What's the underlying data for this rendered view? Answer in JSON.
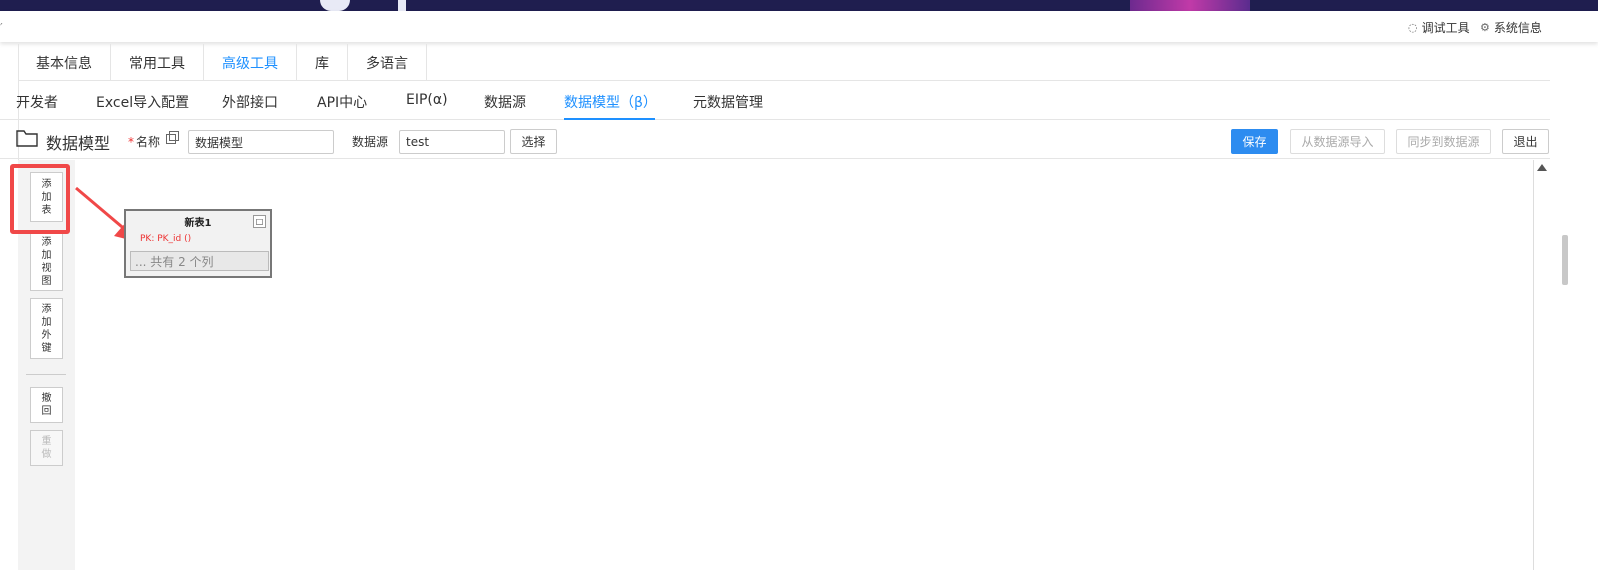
{
  "topbar": {
    "debug_tool": "调试工具",
    "system_info": "系统信息"
  },
  "tabs_primary": [
    {
      "label": "基本信息",
      "active": false
    },
    {
      "label": "常用工具",
      "active": false
    },
    {
      "label": "高级工具",
      "active": true
    },
    {
      "label": "库",
      "active": false
    },
    {
      "label": "多语言",
      "active": false
    }
  ],
  "tabs_secondary": [
    {
      "label": "开发者",
      "active": false
    },
    {
      "label": "Excel导入配置",
      "active": false
    },
    {
      "label": "外部接口",
      "active": false
    },
    {
      "label": "API中心",
      "active": false
    },
    {
      "label": "EIP(α)",
      "active": false
    },
    {
      "label": "数据源",
      "active": false
    },
    {
      "label": "数据模型（β）",
      "active": true
    },
    {
      "label": "元数据管理",
      "active": false
    }
  ],
  "toolbar": {
    "title": "数据模型",
    "name_label": "名称",
    "name_required": "*",
    "name_value": "数据模型",
    "datasource_label": "数据源",
    "datasource_value": "test",
    "select_button": "选择",
    "save_button": "保存",
    "import_button": "从数据源导入",
    "sync_button": "同步到数据源",
    "exit_button": "退出"
  },
  "sidebar": {
    "add_table": "添加表",
    "add_view": "添加视图",
    "add_foreign_key": "添加外键",
    "undo": "撤回",
    "redo": "重做"
  },
  "table_node": {
    "name": "新表1",
    "pk": "PK: PK_id ()",
    "columns_summary": "... 共有 2 个列",
    "minimize_glyph": "□"
  },
  "colors": {
    "accent": "#1e90ff",
    "primary_button": "#2d8cf0",
    "highlight": "#f04848"
  }
}
